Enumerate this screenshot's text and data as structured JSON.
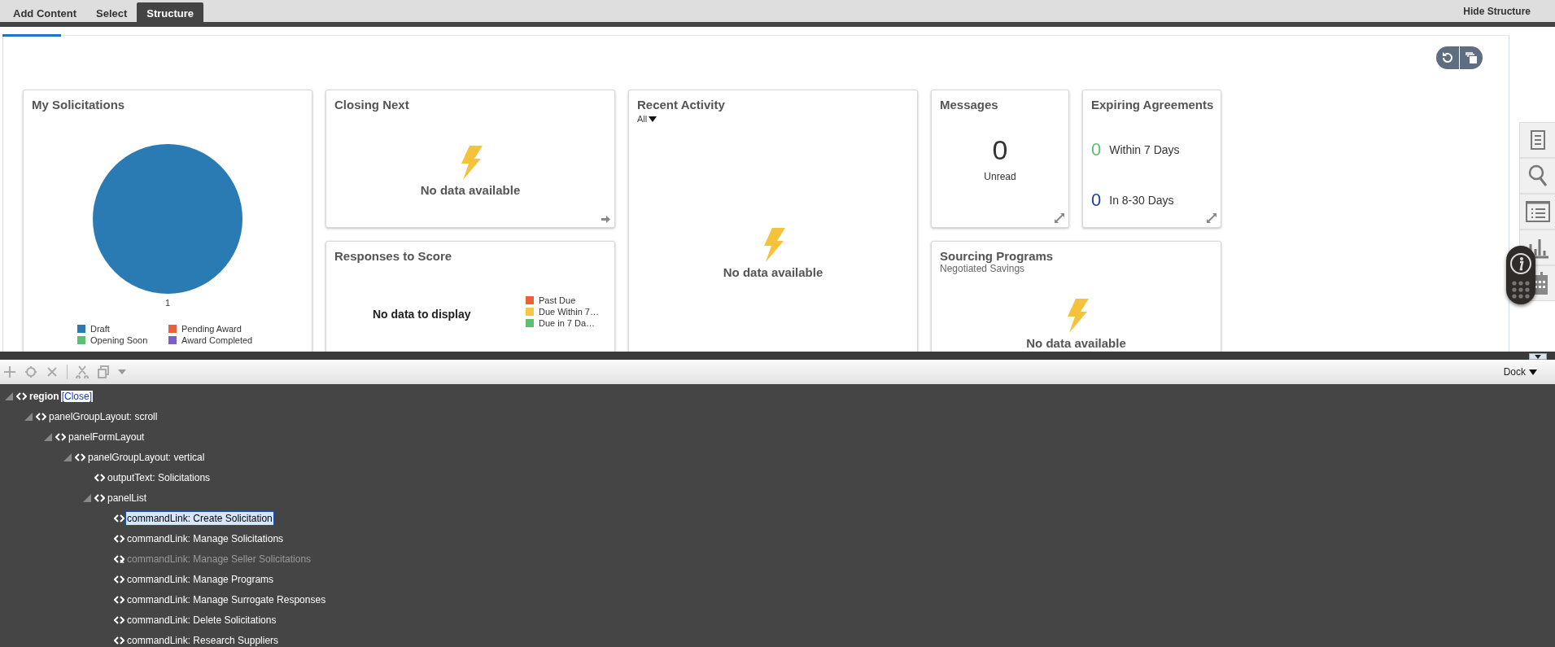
{
  "tabs": [
    {
      "label": "Add Content",
      "selected": false
    },
    {
      "label": "Select",
      "selected": false
    },
    {
      "label": "Structure",
      "selected": true
    }
  ],
  "hide_structure": "Hide Structure",
  "cards": [
    {
      "kind": "pie",
      "title": "My Solicitations",
      "chart_data": {
        "type": "pie",
        "values": [
          1
        ],
        "data_labels": true
      },
      "legend": [
        {
          "label": "Draft",
          "color": "#2a7ab3"
        },
        {
          "label": "Pending Award",
          "color": "#e8603c"
        },
        {
          "label": "Opening Soon",
          "color": "#5dbf73"
        },
        {
          "label": "Award Completed",
          "color": "#7d5ec8"
        }
      ]
    },
    {
      "kind": "empty",
      "title": "Closing Next",
      "message": "No data available"
    },
    {
      "kind": "activity",
      "title": "Recent Activity",
      "filter": "All",
      "message": "No data available"
    },
    {
      "kind": "count",
      "title": "Messages",
      "count": "0",
      "label": "Unread"
    },
    {
      "kind": "expiring",
      "title": "Expiring Agreements",
      "rows": [
        {
          "count": "0",
          "label": "Within 7 Days",
          "color": "#5dbf73"
        },
        {
          "count": "0",
          "label": "In 8-30 Days",
          "color": "#1f3fa8"
        }
      ]
    },
    {
      "kind": "legend_empty",
      "title": "Responses to Score",
      "message": "No data to display",
      "legend": [
        {
          "label": "Past Due",
          "color": "#e8603c"
        },
        {
          "label": "Due Within 7…",
          "color": "#f5c748"
        },
        {
          "label": "Due in 7 Da…",
          "color": "#5dbf73"
        }
      ]
    },
    {
      "kind": "programs",
      "title": "Sourcing Programs",
      "subtitle": "Negotiated Savings",
      "message": "No data available"
    }
  ],
  "structure": {
    "dock": "Dock",
    "tree": [
      {
        "label": "region",
        "link": "[Close]",
        "expanded": true,
        "children": [
          {
            "label": "panelGroupLayout: scroll",
            "expanded": true,
            "children": [
              {
                "label": "panelFormLayout",
                "expanded": true,
                "children": [
                  {
                    "label": "panelGroupLayout: vertical",
                    "expanded": true,
                    "children": [
                      {
                        "label": "outputText: Solicitations"
                      },
                      {
                        "label": "panelList",
                        "expanded": true,
                        "children": [
                          {
                            "label": "commandLink: Create Solicitation",
                            "selected": true,
                            "disabled": false
                          },
                          {
                            "label": "commandLink: Manage Solicitations",
                            "selected": false,
                            "disabled": false
                          },
                          {
                            "label": "commandLink: Manage Seller Solicitations",
                            "selected": false,
                            "disabled": true
                          },
                          {
                            "label": "commandLink: Manage Programs",
                            "selected": false,
                            "disabled": false
                          },
                          {
                            "label": "commandLink: Manage Surrogate Responses",
                            "selected": false,
                            "disabled": false
                          },
                          {
                            "label": "commandLink: Delete Solicitations",
                            "selected": false,
                            "disabled": false
                          },
                          {
                            "label": "commandLink: Research Suppliers",
                            "selected": false,
                            "disabled": false
                          }
                        ]
                      }
                    ]
                  }
                ]
              }
            ]
          }
        ]
      }
    ]
  }
}
